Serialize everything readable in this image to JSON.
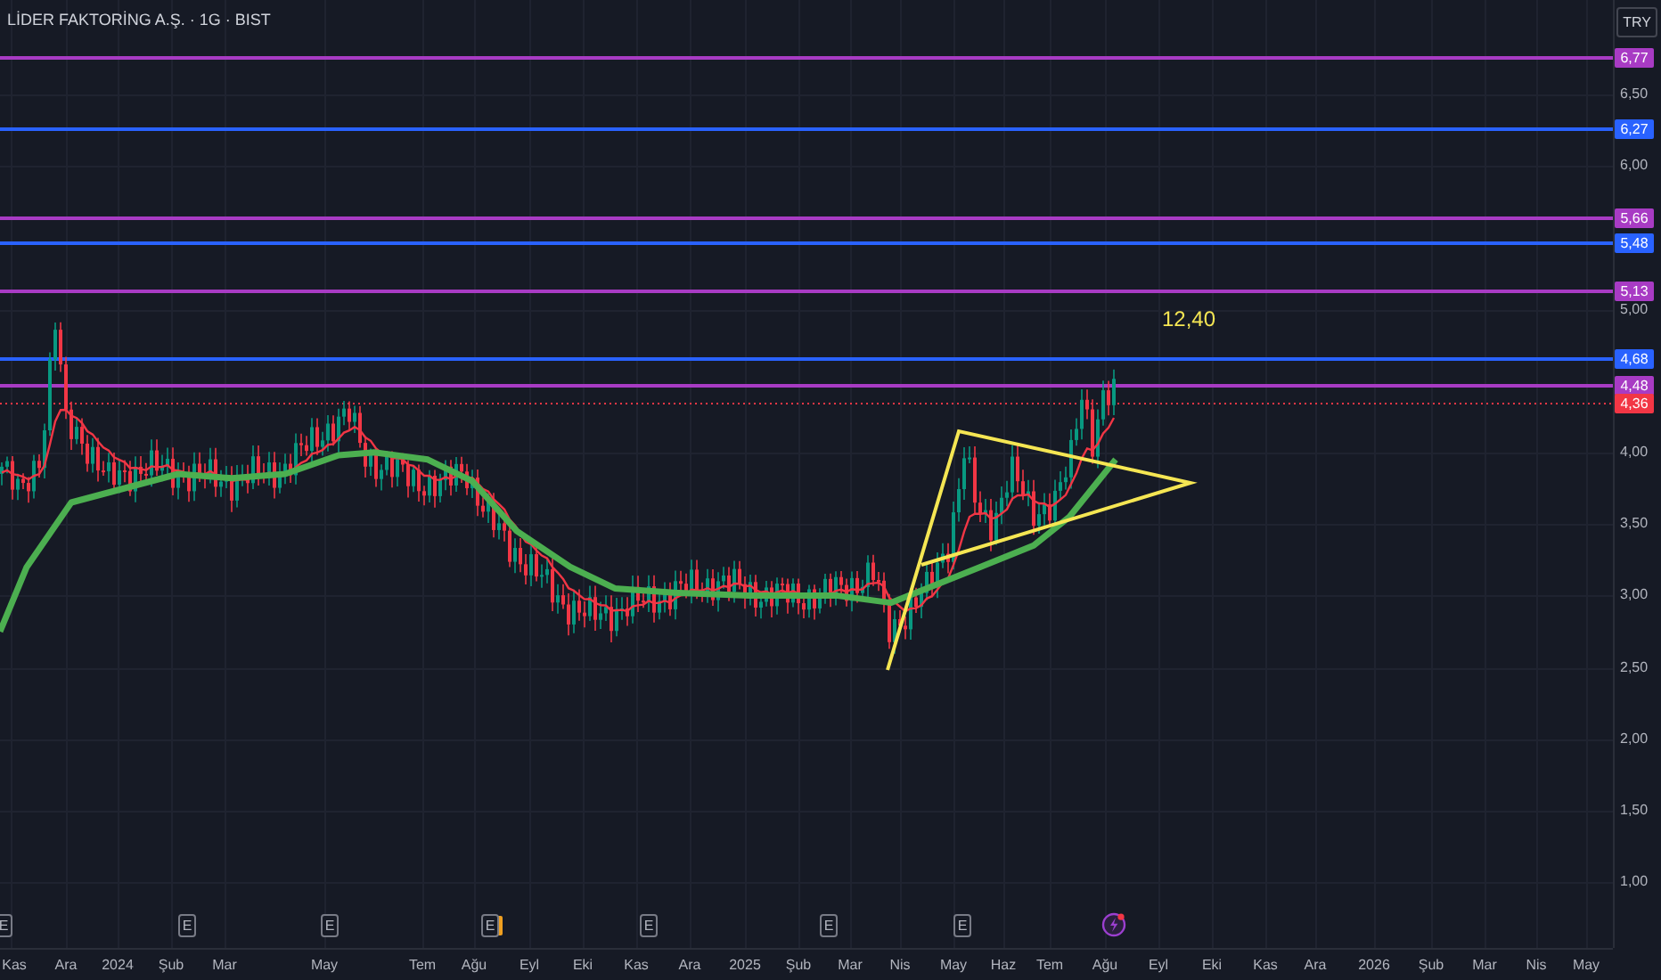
{
  "title": "LİDER FAKTORİNG A.Ş. · 1G · BIST",
  "currency_button": "TRY",
  "price_ticks": [
    "6,50",
    "6,00",
    "5,00",
    "4,00",
    "3,50",
    "3,00",
    "2,50",
    "2,00",
    "1,50",
    "1,00"
  ],
  "levels": [
    {
      "label": "6,77",
      "color": "#a83bc4",
      "kind": "line"
    },
    {
      "label": "6,27",
      "color": "#2962ff",
      "kind": "line"
    },
    {
      "label": "5,66",
      "color": "#a83bc4",
      "kind": "line"
    },
    {
      "label": "5,48",
      "color": "#2962ff",
      "kind": "line"
    },
    {
      "label": "5,13",
      "color": "#a83bc4",
      "kind": "line"
    },
    {
      "label": "4,68",
      "color": "#2962ff",
      "kind": "line"
    },
    {
      "label": "4,48",
      "color": "#a83bc4",
      "kind": "line"
    },
    {
      "label": "4,36",
      "color": "#f23645",
      "kind": "last_price"
    }
  ],
  "annotation": "12,40",
  "events": [
    {
      "kind": "earnings",
      "label": "E"
    },
    {
      "kind": "earnings",
      "label": "E"
    },
    {
      "kind": "earnings",
      "label": "E"
    },
    {
      "kind": "earnings_highlighted",
      "label": "E"
    },
    {
      "kind": "earnings",
      "label": "E"
    },
    {
      "kind": "earnings",
      "label": "E"
    },
    {
      "kind": "earnings",
      "label": "E"
    },
    {
      "kind": "news"
    }
  ],
  "time_axis": [
    "Kas",
    "Ara",
    "2024",
    "Şub",
    "Mar",
    "May",
    "Tem",
    "Ağu",
    "Eyl",
    "Eki",
    "Kas",
    "Ara",
    "2025",
    "Şub",
    "Mar",
    "Nis",
    "May",
    "Haz",
    "Tem",
    "Ağu",
    "Eyl",
    "Eki",
    "Kas",
    "Ara",
    "2026",
    "Şub",
    "Mar",
    "Nis",
    "May"
  ]
}
